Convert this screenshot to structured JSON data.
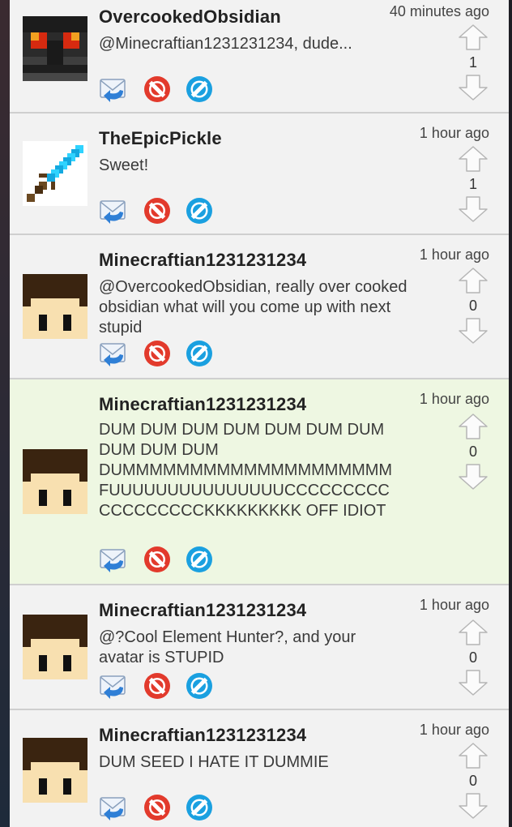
{
  "posts": [
    {
      "username": "OvercookedObsidian",
      "time": "40 minutes ago",
      "message": "@Minecraftian1231231234, dude...",
      "votes": "1",
      "avatar": "obsidian-avatar-icon",
      "highlight": false
    },
    {
      "username": "TheEpicPickle",
      "time": "1 hour ago",
      "message": "Sweet!",
      "votes": "1",
      "avatar": "diamond-sword-avatar-icon",
      "highlight": false
    },
    {
      "username": "Minecraftian1231231234",
      "time": "1 hour ago",
      "message": "@OvercookedObsidian, really over cooked obsidian what will you come up with next stupid",
      "votes": "0",
      "avatar": "steve-face-avatar-icon",
      "highlight": false
    },
    {
      "username": "Minecraftian1231231234",
      "time": "1 hour ago",
      "message": "DUM DUM DUM DUM DUM DUM DUM DUM DUM DUM DUMMMMMMMMMMMMMMMMMMMM FUUUUUUUUUUUUUUUCCCCCCCCC CCCCCCCCCKKKKKKKKK OFF IDIOT",
      "votes": "0",
      "avatar": "steve-face-avatar-icon",
      "highlight": true
    },
    {
      "username": "Minecraftian1231231234",
      "time": "1 hour ago",
      "message": "@?Cool Element Hunter?, and your avatar is STUPID",
      "votes": "0",
      "avatar": "steve-face-avatar-icon",
      "highlight": false
    },
    {
      "username": "Minecraftian1231231234",
      "time": "1 hour ago",
      "message": "DUM SEED I HATE IT DUMMIE",
      "votes": "0",
      "avatar": "steve-face-avatar-icon",
      "highlight": false
    }
  ],
  "colors": {
    "background": "#f2f2f2",
    "highlight": "#eef7e2",
    "reply_blue": "#2f7fd6",
    "block_red": "#e23a2c",
    "report_blue": "#1aa0e0",
    "arrow_gray": "#bdbdbd"
  },
  "icons": {
    "reply": "reply-envelope-icon",
    "block": "block-red-icon",
    "report": "report-blue-icon",
    "upvote": "upvote-arrow-icon",
    "downvote": "downvote-arrow-icon"
  }
}
